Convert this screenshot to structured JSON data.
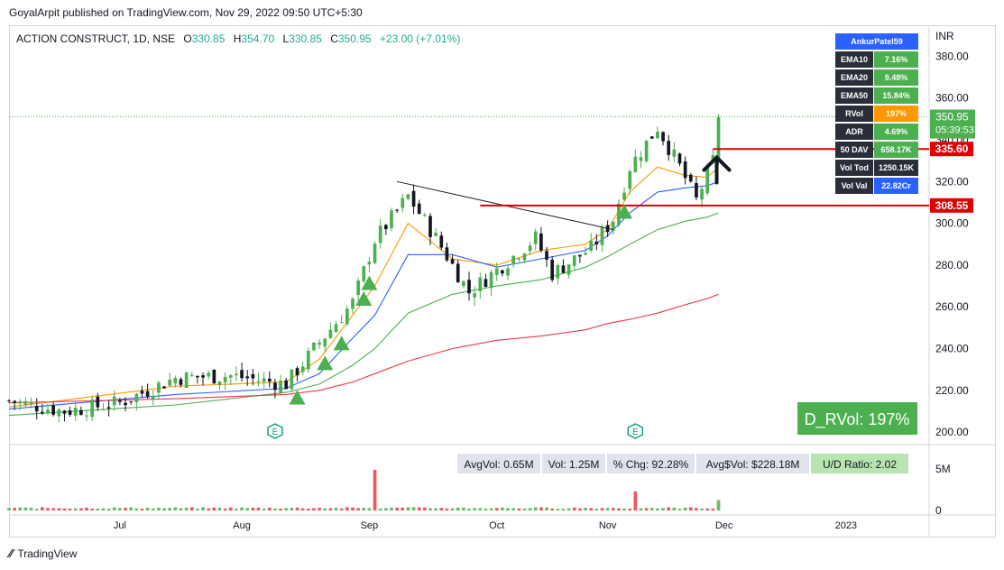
{
  "publish_line": "GoyalArpit published on TradingView.com, Nov 29, 2022 09:50 UTC+5:30",
  "header": {
    "symbol": "ACTION CONSTRUCT, 1D, NSE",
    "o_label": "O",
    "o_value": "330.85",
    "h_label": "H",
    "h_value": "354.70",
    "l_label": "L",
    "l_value": "330.85",
    "c_label": "C",
    "c_value": "350.95",
    "change": "+23.00 (+7.01%)"
  },
  "currency": "INR",
  "stats_table": {
    "title": "AnkurPatel59",
    "rows": [
      {
        "label": "EMA10",
        "value": "7.16%",
        "color": "#4caf50"
      },
      {
        "label": "EMA20",
        "value": "9.48%",
        "color": "#4caf50"
      },
      {
        "label": "EMA50",
        "value": "15.84%",
        "color": "#4caf50"
      },
      {
        "label": "RVol",
        "value": "197%",
        "color": "#ff9800"
      },
      {
        "label": "ADR",
        "value": "4.69%",
        "color": "#4caf50"
      },
      {
        "label": "50 DAV",
        "value": "658.17K",
        "color": "#4caf50"
      },
      {
        "label": "Vol Tod",
        "value": "1250.15K",
        "color": "#2a2e39"
      },
      {
        "label": "Vol Val",
        "value": "22.82Cr",
        "color": "#2962ff"
      }
    ]
  },
  "price_badge": {
    "price": "350.95",
    "countdown": "05:39:53",
    "color": "#4caf50"
  },
  "levels": [
    {
      "price": 335.6,
      "label": "335.60",
      "start_index": 127
    },
    {
      "price": 308.55,
      "label": "308.55",
      "start_index": 85
    }
  ],
  "trendline": {
    "from": {
      "index": 70,
      "price": 320.0
    },
    "to": {
      "index": 109,
      "price": 297.0
    }
  },
  "rvol_box": {
    "text": "D_RVol: 197%",
    "color": "#4caf50"
  },
  "volume_stats": [
    {
      "text": "AvgVol: 0.65M",
      "color": "#e0e3eb"
    },
    {
      "text": "Vol: 1.25M",
      "color": "#e0e3eb"
    },
    {
      "text": "% Chg: 92.28%",
      "color": "#e0e3eb"
    },
    {
      "text": "Avg$Vol: $228.18M",
      "color": "#e0e3eb"
    },
    {
      "text": "U/D Ratio: 2.02",
      "color": "#b7e4b0"
    }
  ],
  "earnings_marker": "E",
  "footer_brand": "TradingView",
  "chart_data": {
    "type": "candlestick",
    "y_axis": {
      "ticks": [
        200,
        220,
        240,
        260,
        280,
        300,
        320,
        340,
        360,
        380
      ],
      "tick_labels": [
        "200.00",
        "220.00",
        "240.00",
        "260.00",
        "280.00",
        "300.00",
        "320.00",
        "340.00",
        "360.00",
        "380.00"
      ],
      "range": [
        194,
        394
      ]
    },
    "volume_axis": {
      "ticks": [
        0,
        5
      ],
      "tick_labels": [
        "0",
        "5M"
      ],
      "range": [
        0,
        7.5
      ]
    },
    "x_labels": [
      {
        "index": 20,
        "label": "Jul"
      },
      {
        "index": 42,
        "label": "Aug"
      },
      {
        "index": 65,
        "label": "Sep"
      },
      {
        "index": 88,
        "label": "Oct"
      },
      {
        "index": 108,
        "label": "Nov"
      },
      {
        "index": 129,
        "label": "Dec"
      },
      {
        "index": 151,
        "label": "2023"
      }
    ],
    "x_index_range": [
      0,
      166
    ],
    "series": [
      {
        "name": "EMA10",
        "color": "#ff9800"
      },
      {
        "name": "EMA20",
        "color": "#2962ff"
      },
      {
        "name": "EMA50",
        "color": "#4caf50"
      },
      {
        "name": "EMA200",
        "color": "#f23645"
      }
    ],
    "buy_markers": [
      52,
      57,
      60,
      64,
      65,
      111
    ],
    "earnings_indices": [
      48,
      113
    ],
    "key_points": [
      {
        "index": 0,
        "close": 215
      },
      {
        "index": 10,
        "close": 210
      },
      {
        "index": 20,
        "close": 214
      },
      {
        "index": 30,
        "close": 226
      },
      {
        "index": 40,
        "close": 227
      },
      {
        "index": 50,
        "close": 223
      },
      {
        "index": 56,
        "close": 243
      },
      {
        "index": 62,
        "close": 262
      },
      {
        "index": 66,
        "close": 292
      },
      {
        "index": 72,
        "close": 313
      },
      {
        "index": 77,
        "close": 293
      },
      {
        "index": 83,
        "close": 267
      },
      {
        "index": 90,
        "close": 282
      },
      {
        "index": 95,
        "close": 293
      },
      {
        "index": 98,
        "close": 276
      },
      {
        "index": 105,
        "close": 288
      },
      {
        "index": 109,
        "close": 302
      },
      {
        "index": 112,
        "close": 327
      },
      {
        "index": 117,
        "close": 346
      },
      {
        "index": 121,
        "close": 327
      },
      {
        "index": 124,
        "close": 311
      },
      {
        "index": 127,
        "close": 330
      },
      {
        "index": 128,
        "close": 351
      }
    ],
    "ema_points": {
      "EMA10": [
        [
          0,
          212
        ],
        [
          30,
          222
        ],
        [
          50,
          224
        ],
        [
          56,
          235
        ],
        [
          62,
          256
        ],
        [
          66,
          270
        ],
        [
          72,
          300
        ],
        [
          80,
          283
        ],
        [
          88,
          280
        ],
        [
          96,
          287
        ],
        [
          104,
          290
        ],
        [
          108,
          297
        ],
        [
          112,
          315
        ],
        [
          117,
          327
        ],
        [
          122,
          323
        ],
        [
          126,
          322
        ],
        [
          128,
          327
        ]
      ],
      "EMA20": [
        [
          0,
          211
        ],
        [
          30,
          218
        ],
        [
          50,
          221
        ],
        [
          56,
          228
        ],
        [
          62,
          245
        ],
        [
          66,
          256
        ],
        [
          72,
          285
        ],
        [
          80,
          285
        ],
        [
          88,
          279
        ],
        [
          96,
          283
        ],
        [
          104,
          287
        ],
        [
          108,
          294
        ],
        [
          112,
          305
        ],
        [
          117,
          315
        ],
        [
          122,
          317
        ],
        [
          126,
          318
        ],
        [
          128,
          320
        ]
      ],
      "EMA50": [
        [
          0,
          208
        ],
        [
          30,
          213
        ],
        [
          50,
          219
        ],
        [
          56,
          223
        ],
        [
          62,
          232
        ],
        [
          66,
          240
        ],
        [
          72,
          257
        ],
        [
          80,
          266
        ],
        [
          88,
          270
        ],
        [
          96,
          273
        ],
        [
          104,
          279
        ],
        [
          108,
          284
        ],
        [
          112,
          290
        ],
        [
          117,
          297
        ],
        [
          122,
          301
        ],
        [
          126,
          303
        ],
        [
          128,
          305
        ]
      ],
      "EMA200": [
        [
          0,
          214
        ],
        [
          30,
          216
        ],
        [
          50,
          218
        ],
        [
          56,
          220
        ],
        [
          62,
          224
        ],
        [
          66,
          228
        ],
        [
          72,
          234
        ],
        [
          80,
          240
        ],
        [
          88,
          244
        ],
        [
          96,
          246
        ],
        [
          104,
          249
        ],
        [
          108,
          252
        ],
        [
          112,
          254
        ],
        [
          117,
          257
        ],
        [
          122,
          261
        ],
        [
          126,
          264
        ],
        [
          128,
          266
        ]
      ]
    },
    "volume": {
      "typical_millions": [
        0.2,
        0.4
      ],
      "spikes": [
        {
          "index": 66,
          "millions": 4.9
        },
        {
          "index": 113,
          "millions": 2.3
        },
        {
          "index": 128,
          "millions": 1.25
        }
      ]
    }
  }
}
